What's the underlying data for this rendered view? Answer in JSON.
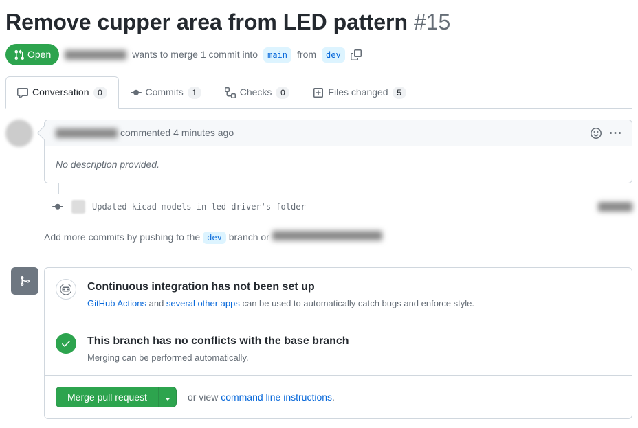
{
  "title": "Remove cupper area from LED pattern",
  "issue_number": "#15",
  "state": "Open",
  "merge_line": {
    "wants": "wants to merge 1 commit into",
    "base": "main",
    "from": "from",
    "head": "dev"
  },
  "tabs": {
    "conversation": {
      "label": "Conversation",
      "count": "0"
    },
    "commits": {
      "label": "Commits",
      "count": "1"
    },
    "checks": {
      "label": "Checks",
      "count": "0"
    },
    "files": {
      "label": "Files changed",
      "count": "5"
    }
  },
  "comment": {
    "action": "commented",
    "time": "4 minutes ago",
    "body": "No description provided."
  },
  "commit": {
    "message": "Updated kicad models in led-driver's folder"
  },
  "push_hint": {
    "prefix": "Add more commits by pushing to the",
    "branch": "dev",
    "mid": "branch or"
  },
  "ci": {
    "title": "Continuous integration has not been set up",
    "link1": "GitHub Actions",
    "and": " and ",
    "link2": "several other apps",
    "suffix": " can be used to automatically catch bugs and enforce style."
  },
  "conflicts": {
    "title": "This branch has no conflicts with the base branch",
    "desc": "Merging can be performed automatically."
  },
  "merge_button": "Merge pull request",
  "cli": {
    "prefix": "or view ",
    "link": "command line instructions",
    "suffix": "."
  }
}
